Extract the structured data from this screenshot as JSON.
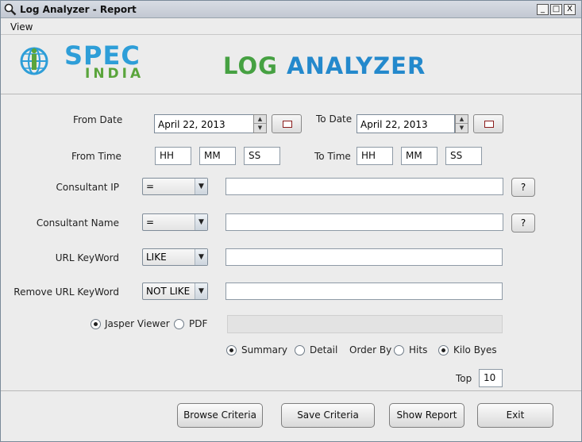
{
  "window": {
    "title": "Log Analyzer - Report",
    "controls": [
      "_",
      "□",
      "X"
    ]
  },
  "menu": {
    "items": [
      "View"
    ]
  },
  "header": {
    "logo_top": "SPEC",
    "logo_bottom": "INDIA",
    "app_title_part1": "LOG ",
    "app_title_part2": "ANALYZER"
  },
  "form": {
    "from_date_label": "From Date",
    "from_date_value": "April 22, 2013",
    "to_date_label": "To Date",
    "to_date_value": "April 22, 2013",
    "from_time_label": "From Time",
    "from_time": {
      "hh": "HH",
      "mm": "MM",
      "ss": "SS"
    },
    "to_time_label": "To Time",
    "to_time": {
      "hh": "HH",
      "mm": "MM",
      "ss": "SS"
    },
    "consultant_ip_label": "Consultant IP",
    "consultant_ip_operator": "=",
    "consultant_ip_value": "",
    "consultant_name_label": "Consultant Name",
    "consultant_name_operator": "=",
    "consultant_name_value": "",
    "url_keyword_label": "URL KeyWord",
    "url_keyword_operator": "LIKE",
    "url_keyword_value": "",
    "remove_url_keyword_label": "Remove URL KeyWord",
    "remove_url_keyword_operator": "NOT LIKE",
    "remove_url_keyword_value": "",
    "help_button": "?",
    "viewer_jasper": "Jasper Viewer",
    "viewer_pdf": "PDF",
    "viewer_selected": "Jasper Viewer",
    "summary_label": "Summary",
    "detail_label": "Detail",
    "report_selected": "Summary",
    "order_by_label": "Order By",
    "hits_label": "Hits",
    "kilobytes_label": "Kilo Byes",
    "order_selected": "Kilo Byes",
    "top_label": "Top",
    "top_value": "10"
  },
  "footer": {
    "browse_criteria": "Browse Criteria",
    "save_criteria": "Save Criteria",
    "show_report": "Show Report",
    "exit": "Exit"
  },
  "colors": {
    "brand_blue": "#2489cc",
    "brand_green": "#46a142",
    "window_bg": "#ececec"
  }
}
